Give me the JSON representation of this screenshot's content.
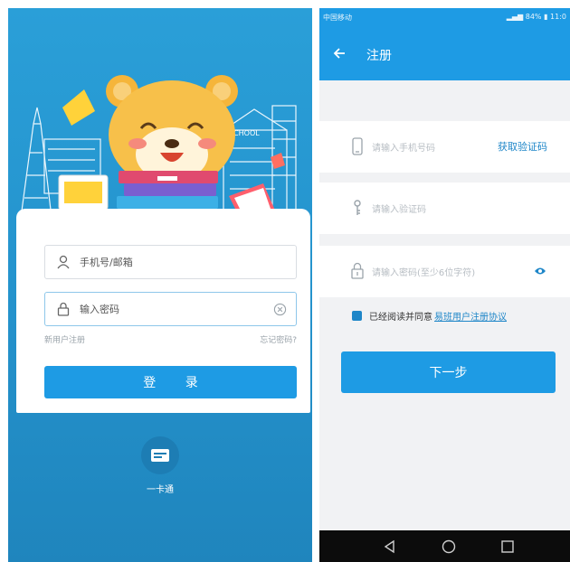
{
  "login": {
    "account_placeholder": "手机号/邮箱",
    "password_placeholder": "输入密码",
    "register_link": "新用户注册",
    "forgot_link": "忘记密码?",
    "login_button": "登 录",
    "one_card_pass_label": "一卡通",
    "school_sign": "SCHOOL",
    "icons": {
      "account": "user-icon",
      "password": "lock-icon",
      "clear": "clear-icon",
      "one_card_pass": "card-icon"
    }
  },
  "register": {
    "status_bar": {
      "carrier": "中国移动",
      "battery": "84%",
      "time": "11:0"
    },
    "title": "注册",
    "phone_placeholder": "请输入手机号码",
    "get_code_button": "获取验证码",
    "code_placeholder": "请输入验证码",
    "password_placeholder": "请输入密码(至少6位字符)",
    "agree_text": "已经阅读并同意",
    "agreement_link": "易班用户注册协议",
    "next_button": "下一步",
    "icons": {
      "back": "back-arrow-icon",
      "phone": "phone-icon",
      "code": "key-icon",
      "password": "lock-icon",
      "show_password": "eye-icon",
      "nav_back": "nav-back-icon",
      "nav_home": "nav-home-icon",
      "nav_recent": "nav-recent-icon"
    }
  },
  "colors": {
    "primary": "#1e9be4",
    "login_background": "#2492cc",
    "link": "#1e86c8",
    "nav_bar": "#0c0c0c"
  }
}
